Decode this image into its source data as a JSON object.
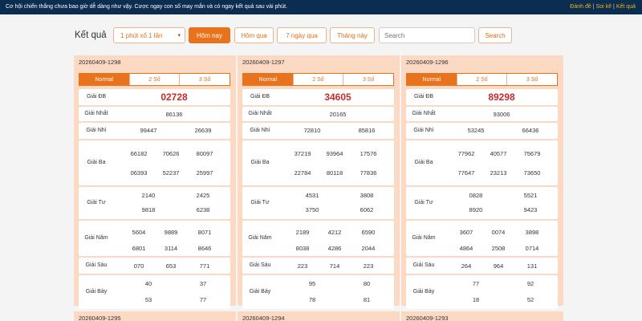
{
  "topbar": {
    "message": "Cơ hội chiến thắng chưa bao giờ dễ dàng như vậy. Cược ngay con số may mắn và có ngay kết quả sau vài phút.",
    "links": [
      "Đánh đề",
      "Soi kê",
      "Kết quả"
    ]
  },
  "filter": {
    "label": "Kết quả",
    "select_value": "1 phút xổ 1 lần",
    "buttons": [
      "Hôm nay",
      "Hôm qua",
      "7 ngày qua",
      "Tháng này"
    ],
    "search_placeholder": "Search",
    "search_button": "Search"
  },
  "tabs": [
    "Normal",
    "2 Số",
    "3 Số"
  ],
  "labels": {
    "db": "Giải ĐB",
    "nhat": "Giải Nhất",
    "nhi": "Giải Nhì",
    "ba": "Giải Ba",
    "tu": "Giải Tư",
    "nam": "Giải Năm",
    "sau": "Giải Sáu",
    "bay": "Giải Bảy"
  },
  "draws": [
    {
      "id": "20260409-1298",
      "db": "02728",
      "nhat": "86136",
      "nhi": [
        "99447",
        "26639"
      ],
      "ba": [
        "66182",
        "70626",
        "80097",
        "06393",
        "52237",
        "25997"
      ],
      "tu": [
        "2140",
        "2425",
        "9818",
        "6238"
      ],
      "nam": [
        "5604",
        "9889",
        "8071",
        "6801",
        "3114",
        "8646"
      ],
      "sau": [
        "070",
        "653",
        "771"
      ],
      "bay": [
        "40",
        "37",
        "53",
        "77"
      ]
    },
    {
      "id": "20260409-1297",
      "db": "34605",
      "nhat": "20165",
      "nhi": [
        "72810",
        "85816"
      ],
      "ba": [
        "37219",
        "93964",
        "17576",
        "22784",
        "80118",
        "77836"
      ],
      "tu": [
        "4531",
        "3808",
        "3750",
        "6062"
      ],
      "nam": [
        "2189",
        "4212",
        "6590",
        "8038",
        "4286",
        "2044"
      ],
      "sau": [
        "223",
        "714",
        "223"
      ],
      "bay": [
        "95",
        "80",
        "78",
        "81"
      ]
    },
    {
      "id": "20260409-1296",
      "db": "89298",
      "nhat": "93006",
      "nhi": [
        "53245",
        "66436"
      ],
      "ba": [
        "77962",
        "40577",
        "75679",
        "77647",
        "23213",
        "73650"
      ],
      "tu": [
        "0828",
        "5521",
        "8920",
        "9423"
      ],
      "nam": [
        "3607",
        "0074",
        "3898",
        "4864",
        "2508",
        "0714"
      ],
      "sau": [
        "264",
        "964",
        "131"
      ],
      "bay": [
        "77",
        "92",
        "18",
        "52"
      ]
    }
  ],
  "next_draws": [
    "20260409-1295",
    "20260409-1294",
    "20260409-1293"
  ]
}
